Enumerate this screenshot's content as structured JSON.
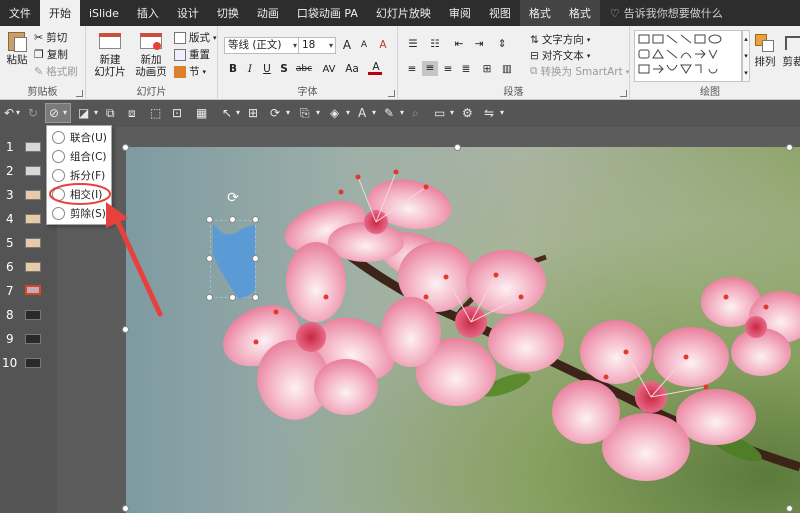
{
  "tabs": [
    {
      "label": "文件"
    },
    {
      "label": "开始"
    },
    {
      "label": "iSlide"
    },
    {
      "label": "插入"
    },
    {
      "label": "设计"
    },
    {
      "label": "切换"
    },
    {
      "label": "动画"
    },
    {
      "label": "口袋动画 PA"
    },
    {
      "label": "幻灯片放映"
    },
    {
      "label": "审阅"
    },
    {
      "label": "视图"
    },
    {
      "label": "格式"
    },
    {
      "label": "格式"
    }
  ],
  "tell_me": "告诉我你想要做什么",
  "ribbon": {
    "clipboard": {
      "label": "剪贴板",
      "paste": "粘贴",
      "cut": "剪切",
      "copy": "复制",
      "format_painter": "格式刷"
    },
    "slides": {
      "label": "幻灯片",
      "new_slide": "新建",
      "new_slide2": "幻灯片",
      "reuse": "新加",
      "reuse2": "动画页",
      "layout": "版式",
      "reset": "重置",
      "section": "节"
    },
    "font": {
      "label": "字体",
      "font_name": "等线 (正文)",
      "font_size": "18",
      "bold": "B",
      "italic": "I",
      "underline": "U",
      "strike": "S",
      "shadow": "abc",
      "spacing": "AV",
      "case": "Aa",
      "grow": "A",
      "shrink": "A",
      "clear": "A",
      "color": "A"
    },
    "paragraph": {
      "label": "段落",
      "text_direction": "文字方向",
      "align_text": "对齐文本",
      "smartart": "转换为 SmartArt"
    },
    "drawing": {
      "label": "绘图",
      "arrange": "排列",
      "crop": "剪裁"
    }
  },
  "slides": [
    {
      "num": "1"
    },
    {
      "num": "2"
    },
    {
      "num": "3"
    },
    {
      "num": "4"
    },
    {
      "num": "5"
    },
    {
      "num": "6"
    },
    {
      "num": "7"
    },
    {
      "num": "8"
    },
    {
      "num": "9"
    },
    {
      "num": "10"
    }
  ],
  "merge_menu": {
    "items": [
      {
        "label": "联合(U)"
      },
      {
        "label": "组合(C)"
      },
      {
        "label": "拆分(F)"
      },
      {
        "label": "相交(I)"
      },
      {
        "label": "剪除(S)"
      }
    ],
    "highlighted_index": 3
  },
  "colors": {
    "accent": "#d24726",
    "shape_fill": "#5b9bd5",
    "annotation": "#e8413c"
  }
}
